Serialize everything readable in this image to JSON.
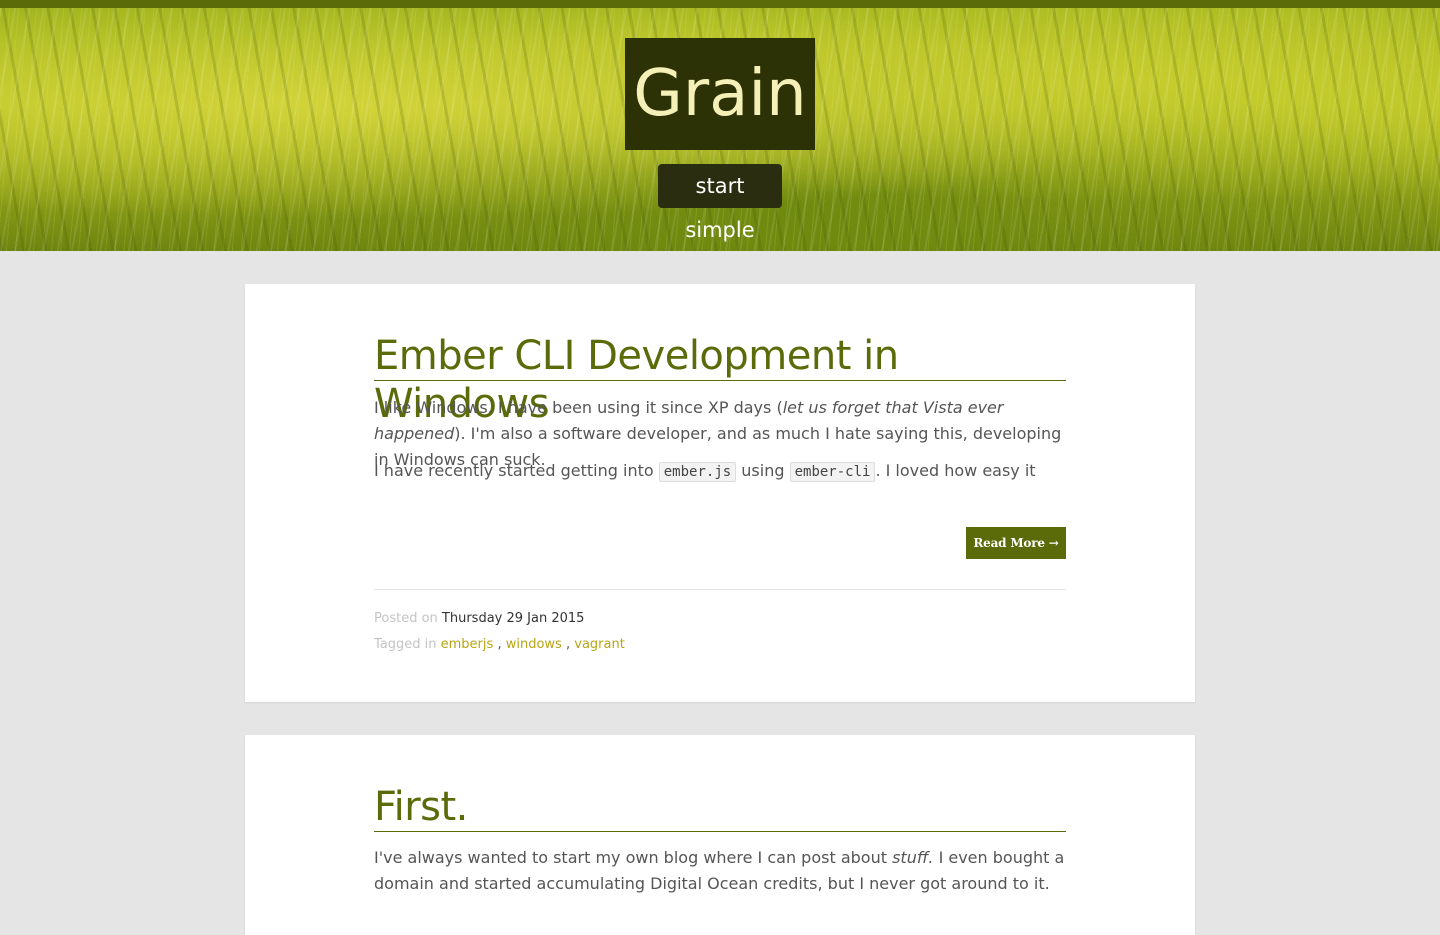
{
  "site": {
    "title": "Grain",
    "tagline": "start simple"
  },
  "colors": {
    "accent": "#5b6b0a",
    "title_bg": "#2d3206",
    "tag_link": "#b8a518"
  },
  "posts": [
    {
      "title": "Ember CLI Development in Windows",
      "p1_a": "I like Windows. I have been using it since XP days (",
      "p1_em": "let us forget that Vista ever happened",
      "p1_b": "). I'm also a software developer, and as much I hate saying this, developing in Windows can suck.",
      "p2_a": "I have recently started getting into",
      "code1": "ember.js",
      "p2_b": "using",
      "code2": "ember-cli",
      "p2_c": ". I loved how easy it",
      "read_more": "Read More →",
      "posted_label": "Posted on",
      "date": "Thursday 29 Jan 2015",
      "tagged_label": "Tagged in",
      "tags": [
        "emberjs",
        "windows",
        "vagrant"
      ],
      "tag_sep": ","
    },
    {
      "title": "First.",
      "p1_a": "I've always wanted to start my own blog where I can post about",
      "p1_em": "stuff.",
      "p1_b": "I even bought a domain and started accumulating Digital Ocean credits, but I never got around to it."
    }
  ]
}
